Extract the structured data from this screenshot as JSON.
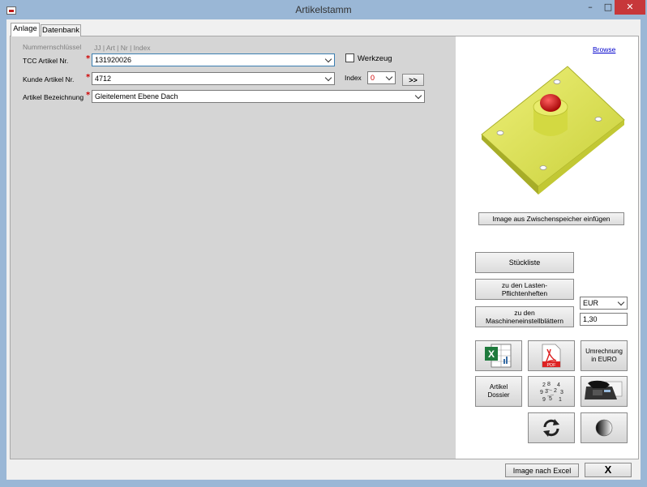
{
  "window": {
    "title": "Artikelstamm",
    "minimize": "–",
    "maximize": "□",
    "close": "✕"
  },
  "tabs": [
    {
      "label": "Anlage"
    },
    {
      "label": "Datenbank"
    }
  ],
  "form": {
    "nummernschluessel_label": "Nummernschlüssel",
    "nummernschluessel_hint": "JJ | Art | Nr | Index",
    "tcc_label": "TCC Artikel Nr.",
    "tcc_value": "131920026",
    "kunde_label": "Kunde Artikel Nr.",
    "kunde_value": "4712",
    "bezeichnung_label": "Artikel Bezeichnung",
    "bezeichnung_value": "Gleitelement Ebene Dach",
    "required_marker": "*",
    "werkzeug_label": "Werkzeug",
    "index_label": "Index",
    "index_value": "0",
    "next_button": ">>"
  },
  "right": {
    "browse_link": "Browse",
    "paste_image_button": "Image aus Zwischenspeicher einfügen",
    "stueckliste_button": "Stückliste",
    "lastenheft_button_line1": "zu den Lasten-",
    "lastenheft_button_line2": "Pflichtenheften",
    "maschinen_button_line1": "zu den",
    "maschinen_button_line2": "Maschineneinstellblättern",
    "currency_value": "EUR",
    "rate_value": "1,30",
    "umrechnung_line1": "Umrechnung",
    "umrechnung_line2": "in EURO",
    "dossier_line1": "Artikel",
    "dossier_line2": "Dossier",
    "pdf_label": "PDF"
  },
  "footer": {
    "excel_button": "Image nach Excel",
    "close_button": "X"
  },
  "colors": {
    "titlebar": "#9ab7d6",
    "close_button": "#c7373a",
    "required": "#d00000",
    "link": "#0000cc",
    "part_body": "#d8e04a",
    "part_red": "#d81414"
  }
}
